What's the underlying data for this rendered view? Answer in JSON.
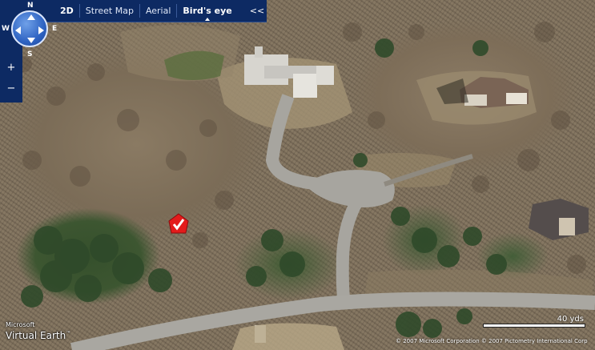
{
  "toolbar": {
    "mode_2d": "2D",
    "mode_street": "Street Map",
    "mode_aerial": "Aerial",
    "mode_birdseye": "Bird's eye",
    "collapse": "<<"
  },
  "nav": {
    "north": "N",
    "south": "S",
    "east": "E",
    "west": "W",
    "zoom_in": "+",
    "zoom_out": "−"
  },
  "branding": {
    "brand_line1": "Microsoft",
    "brand_line2": "Virtual Earth",
    "trademark": "™"
  },
  "scale": {
    "label": "40 yds"
  },
  "copyright": "© 2007 Microsoft Corporation   © 2007 Pictometry International Corp",
  "colors": {
    "toolbar_bg": "#0d2a63",
    "pin": "#e31b1b",
    "compass": "#2e63c2"
  }
}
